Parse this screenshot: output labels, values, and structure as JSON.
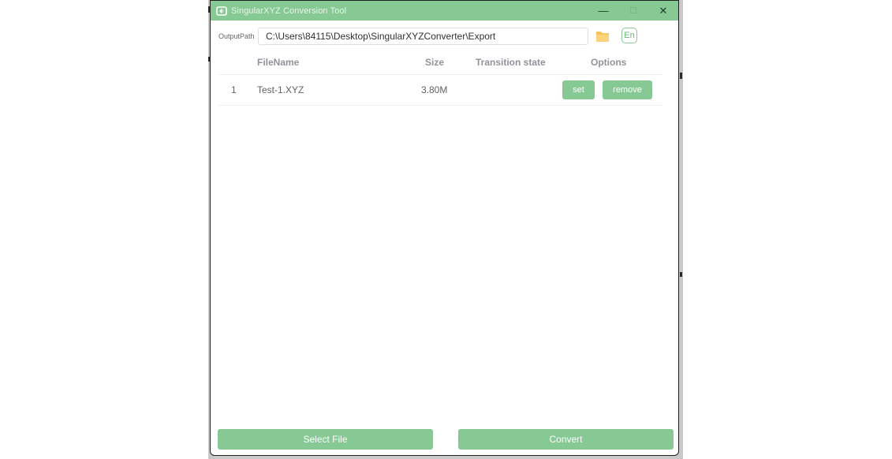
{
  "window": {
    "title": "SingularXYZ Conversion Tool",
    "minimize": "—",
    "maximize": "☐",
    "close": "✕"
  },
  "output_path": {
    "label": "OutputPath",
    "value": "C:\\Users\\84115\\Desktop\\SingularXYZConverter\\Export",
    "lang_button": "En"
  },
  "table": {
    "headers": {
      "filename": "FileName",
      "size": "Size",
      "state": "Transition state",
      "options": "Options"
    },
    "rows": [
      {
        "index": "1",
        "filename": "Test-1.XYZ",
        "size": "3.80M",
        "state": "",
        "set_label": "set",
        "remove_label": "remove"
      }
    ]
  },
  "footer": {
    "select_file": "Select File",
    "convert": "Convert"
  },
  "colors": {
    "accent": "#86c995",
    "folder": "#f7c35c"
  }
}
